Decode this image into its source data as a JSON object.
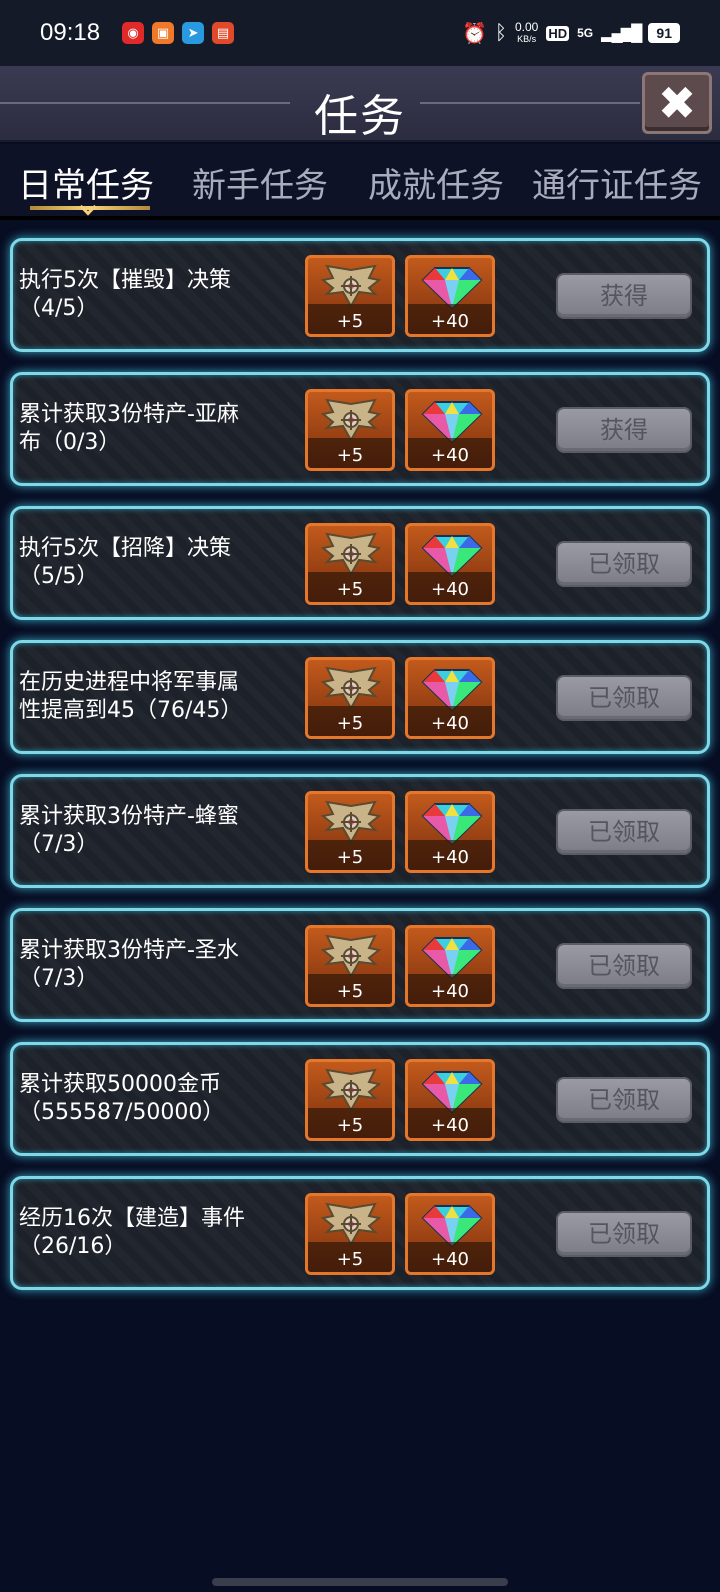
{
  "status_bar": {
    "time": "09:18",
    "net_speed_value": "0.00",
    "net_speed_unit": "KB/s",
    "hd": "HD",
    "signal": "5G",
    "battery": "91"
  },
  "header": {
    "title": "任务",
    "close_icon": "close-icon"
  },
  "tabs": [
    {
      "label": "日常任务",
      "active": true
    },
    {
      "label": "新手任务",
      "active": false
    },
    {
      "label": "成就任务",
      "active": false
    },
    {
      "label": "通行证任务",
      "active": false
    }
  ],
  "tasks": [
    {
      "line1": "执行5次【摧毁】决策",
      "line2": "（4/5）",
      "medal_reward": "+5",
      "gem_reward": "+40",
      "button": "获得"
    },
    {
      "line1": "累计获取3份特产-亚麻",
      "line2": "布（0/3）",
      "medal_reward": "+5",
      "gem_reward": "+40",
      "button": "获得"
    },
    {
      "line1": "执行5次【招降】决策",
      "line2": "（5/5）",
      "medal_reward": "+5",
      "gem_reward": "+40",
      "button": "已领取"
    },
    {
      "line1": "在历史进程中将军事属",
      "line2": "性提高到45（76/45）",
      "medal_reward": "+5",
      "gem_reward": "+40",
      "button": "已领取"
    },
    {
      "line1": "累计获取3份特产-蜂蜜",
      "line2": "（7/3）",
      "medal_reward": "+5",
      "gem_reward": "+40",
      "button": "已领取"
    },
    {
      "line1": "累计获取3份特产-圣水",
      "line2": "（7/3）",
      "medal_reward": "+5",
      "gem_reward": "+40",
      "button": "已领取"
    },
    {
      "line1": "累计获取50000金币",
      "line2": "（555587/50000）",
      "medal_reward": "+5",
      "gem_reward": "+40",
      "button": "已领取"
    },
    {
      "line1": "经历16次【建造】事件",
      "line2": "（26/16）",
      "medal_reward": "+5",
      "gem_reward": "+40",
      "button": "已领取"
    }
  ],
  "colors": {
    "panel_border": "#7fd8e6",
    "reward_orange": "#e6762a",
    "button_gray": "#8a8a94"
  }
}
